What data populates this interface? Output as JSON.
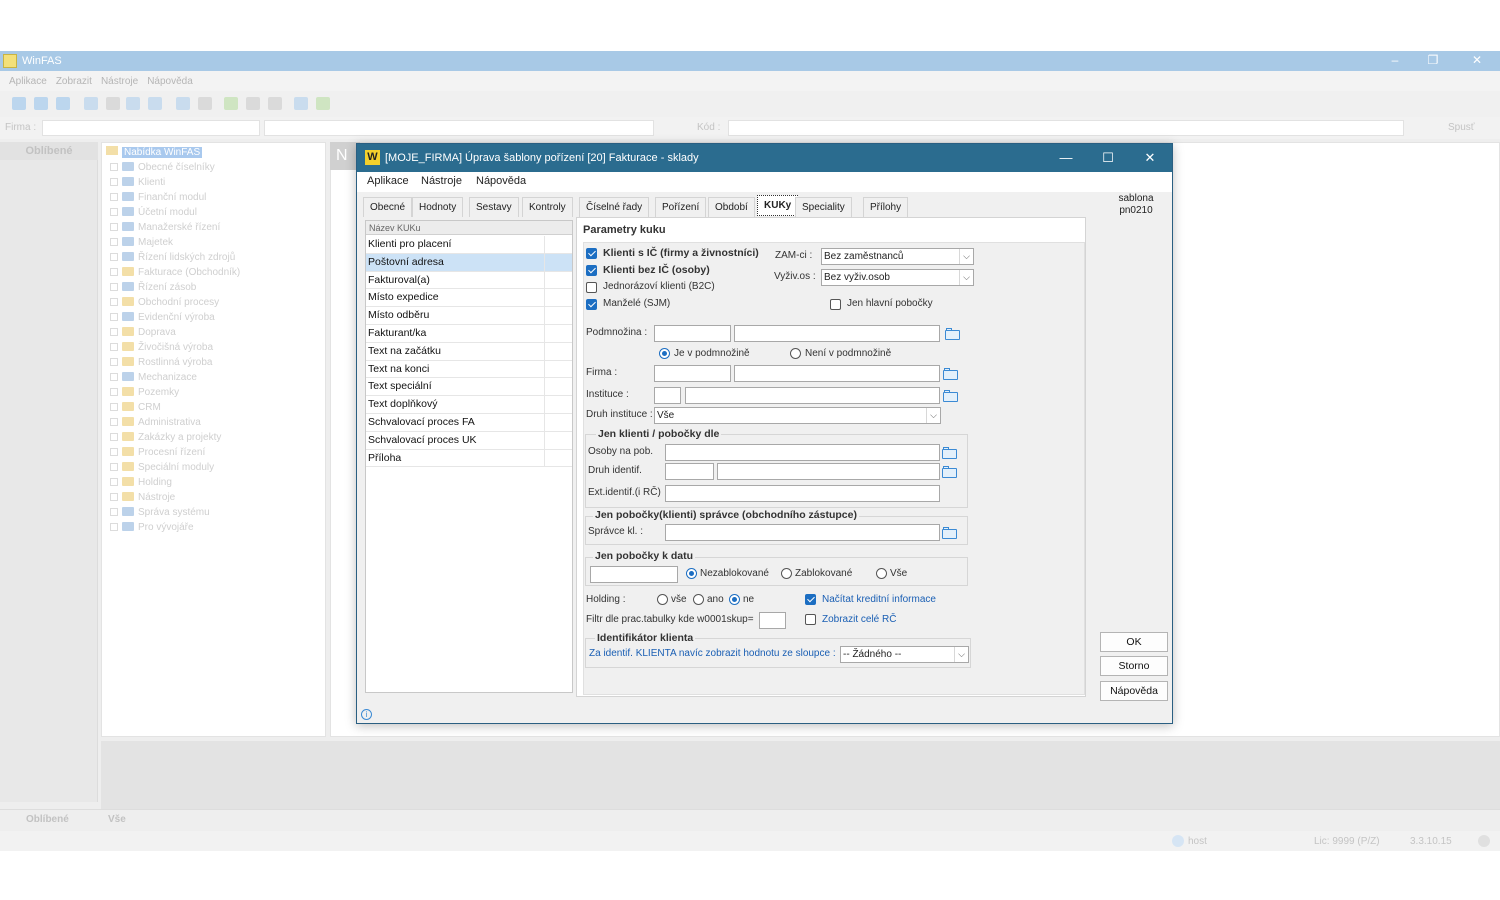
{
  "app": {
    "title": "WinFAS",
    "menu": [
      "Aplikace",
      "Zobrazit",
      "Nástroje",
      "Nápověda"
    ],
    "filter": {
      "firma_label": "Firma :",
      "kod_label": "Kód :",
      "run_label": "Spusť"
    },
    "favorites_header": "Oblíbené",
    "tree_root": "Nabídka WinFAS",
    "tree_items": [
      {
        "label": "Obecné číselníky",
        "color": "blue"
      },
      {
        "label": "Klienti",
        "color": "blue"
      },
      {
        "label": "Finanční modul",
        "color": "blue"
      },
      {
        "label": "Účetní modul",
        "color": "blue"
      },
      {
        "label": "Manažerské řízení",
        "color": "blue"
      },
      {
        "label": "Majetek",
        "color": "blue"
      },
      {
        "label": "Řízení lidských zdrojů",
        "color": "blue"
      },
      {
        "label": "Fakturace (Obchodník)",
        "color": "yellow"
      },
      {
        "label": "Řízení zásob",
        "color": "blue"
      },
      {
        "label": "Obchodní procesy",
        "color": "yellow"
      },
      {
        "label": "Evidenční výroba",
        "color": "blue"
      },
      {
        "label": "Doprava",
        "color": "yellow"
      },
      {
        "label": "Živočišná výroba",
        "color": "yellow"
      },
      {
        "label": "Rostlinná výroba",
        "color": "yellow"
      },
      {
        "label": "Mechanizace",
        "color": "blue"
      },
      {
        "label": "Pozemky",
        "color": "yellow"
      },
      {
        "label": "CRM",
        "color": "yellow"
      },
      {
        "label": "Administrativa",
        "color": "yellow"
      },
      {
        "label": "Zakázky a projekty",
        "color": "yellow"
      },
      {
        "label": "Procesní řízení",
        "color": "yellow"
      },
      {
        "label": "Speciální moduly",
        "color": "yellow"
      },
      {
        "label": "Holding",
        "color": "yellow"
      },
      {
        "label": "Nástroje",
        "color": "yellow"
      },
      {
        "label": "Správa systému",
        "color": "blue"
      },
      {
        "label": "Pro vývojáře",
        "color": "blue"
      }
    ],
    "bottom_tabs": [
      "Oblíbené",
      "Vše"
    ],
    "status": {
      "user": "host",
      "lic": "Lic: 9999 (P/Z)",
      "version": "3.3.10.15"
    }
  },
  "dialog": {
    "title": "[MOJE_FIRMA] Úprava šablony pořízení [20] Fakturace - sklady",
    "menu": [
      "Aplikace",
      "Nástroje",
      "Nápověda"
    ],
    "tabs": [
      "Obecné",
      "Hodnoty",
      "Sestavy",
      "Kontroly",
      "Číselné řady",
      "Pořízení",
      "Období",
      "KUKy",
      "Speciality",
      "Přílohy"
    ],
    "active_tab": "KUKy",
    "template_name": "sablona",
    "template_code": "pn0210",
    "list_header": "Název KUKu",
    "list_items": [
      "Klienti pro placení",
      "Poštovní adresa",
      "Fakturoval(a)",
      "Místo expedice",
      "Místo odběru",
      "Fakturant/ka",
      "Text na začátku",
      "Text na konci",
      "Text speciální",
      "Text doplňkový",
      "Schvalovací proces FA",
      "Schvalovací proces UK",
      "Příloha"
    ],
    "selected_item": "Poštovní adresa",
    "params": {
      "heading": "Parametry kuku",
      "cb_klienti_ic": "Klienti s IČ (firmy a živnostníci)",
      "cb_klienti_bez_ic": "Klienti bez IČ (osoby)",
      "cb_jednorazovi": "Jednorázoví klienti (B2C)",
      "cb_manzele": "Manželé (SJM)",
      "zam_label": "ZAM-ci :",
      "zam_value": "Bez zaměstnanců",
      "vyziv_label": "Vyživ.os :",
      "vyziv_value": "Bez vyživ.osob",
      "cb_hlavni_pobocky": "Jen hlavní pobočky",
      "podmnozina_label": "Podmnožina :",
      "rb_je_v": "Je v podmnožině",
      "rb_neni_v": "Není v podmnožině",
      "firma_label": "Firma :",
      "instituce_label": "Instituce :",
      "druh_instituce_label": "Druh instituce :",
      "druh_instituce_value": "Vše",
      "group_jen_klienti": "Jen klienti / pobočky dle",
      "osoby_label": "Osoby na pob.",
      "druh_identif_label": "Druh identif.",
      "ext_identif_label": "Ext.identif.(i RČ)",
      "group_spravce": "Jen pobočky(klienti) správce (obchodního zástupce)",
      "spravce_label": "Správce kl. :",
      "group_k_datu": "Jen pobočky k datu",
      "rb_nezablokovane": "Nezablokované",
      "rb_zablokovane": "Zablokované",
      "rb_vse": "Vše",
      "holding_label": "Holding :",
      "rb_holding_vse": "vše",
      "rb_holding_ano": "ano",
      "rb_holding_ne": "ne",
      "cb_kreditni": "Načítat kreditní informace",
      "cb_cele_rc": "Zobrazit celé RČ",
      "filtr_label": "Filtr dle prac.tabulky kde w0001skup=",
      "group_identifikator": "Identifikátor klienta",
      "identif_label": "Za identif. KLIENTA navíc zobrazit hodnotu ze sloupce :",
      "identif_value": "-- Žádného --"
    },
    "buttons": {
      "ok": "OK",
      "storno": "Storno",
      "napoveda": "Nápověda"
    }
  }
}
